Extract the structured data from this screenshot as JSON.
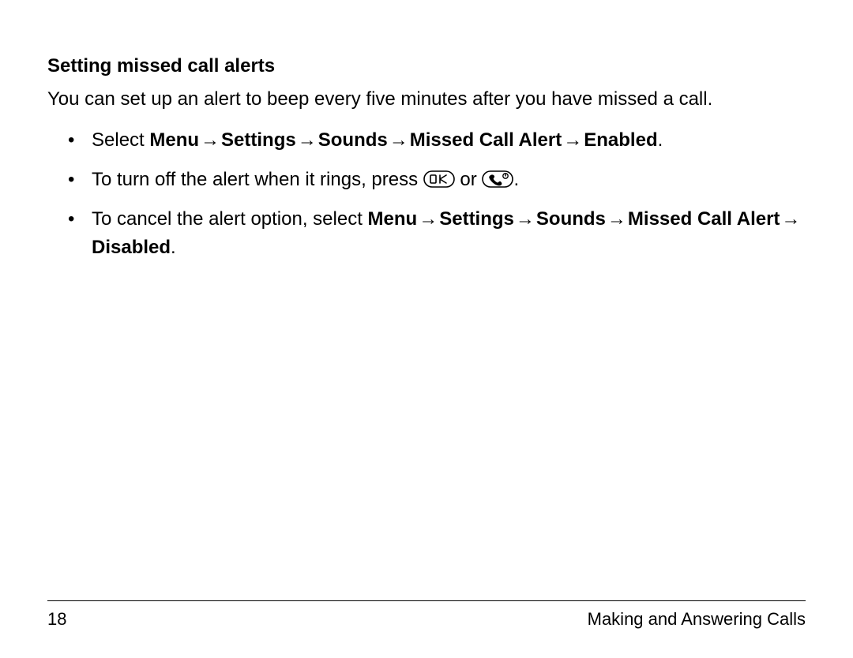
{
  "heading": "Setting missed call alerts",
  "intro": "You can set up an alert to beep every five minutes after you have missed a call.",
  "arrow": "→",
  "bullet1": {
    "prefix": "Select ",
    "path": [
      "Menu",
      "Settings",
      "Sounds",
      "Missed Call Alert",
      "Enabled"
    ],
    "suffix": "."
  },
  "bullet2": {
    "prefix": "To turn off the alert when it rings, press ",
    "mid": " or ",
    "suffix": "."
  },
  "bullet3": {
    "prefix": "To cancel the alert option, select ",
    "path": [
      "Menu",
      "Settings",
      "Sounds",
      "Missed Call Alert",
      "Disabled"
    ],
    "suffix": "."
  },
  "footer": {
    "page_number": "18",
    "section": "Making and Answering Calls"
  },
  "icons": {
    "ok_key": "ok-key-icon",
    "end_key": "end-call-key-icon"
  }
}
